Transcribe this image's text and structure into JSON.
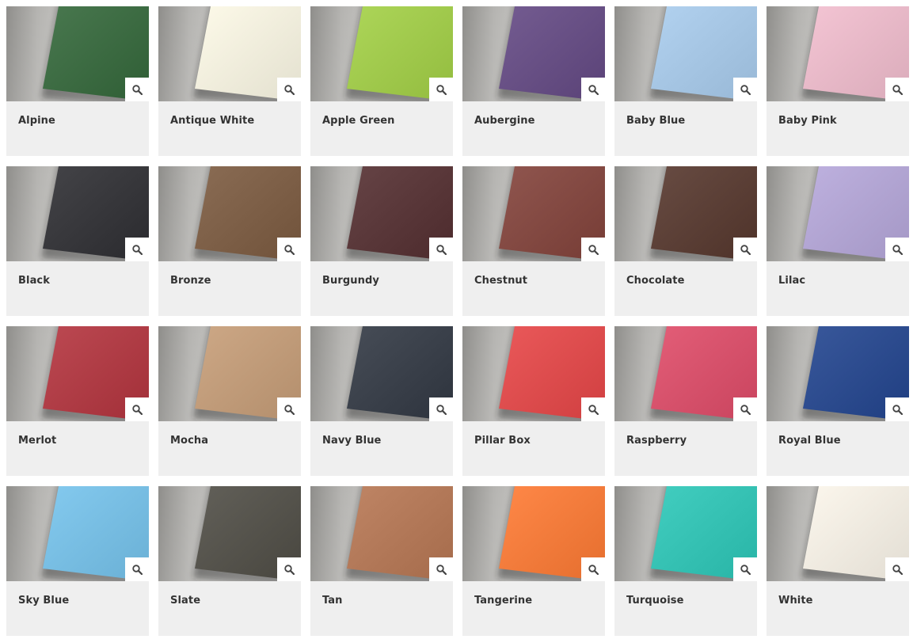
{
  "swatches": [
    {
      "name": "Alpine",
      "color": "#3f6e45"
    },
    {
      "name": "Antique White",
      "color": "#f3f0df"
    },
    {
      "name": "Apple Green",
      "color": "#a3cc4f"
    },
    {
      "name": "Aubergine",
      "color": "#6a5287"
    },
    {
      "name": "Baby Blue",
      "color": "#a8c8e6"
    },
    {
      "name": "Baby Pink",
      "color": "#eabbca"
    },
    {
      "name": "Black",
      "color": "#3a3a3e"
    },
    {
      "name": "Bronze",
      "color": "#80624a"
    },
    {
      "name": "Burgundy",
      "color": "#5c3a3c"
    },
    {
      "name": "Chestnut",
      "color": "#864c45"
    },
    {
      "name": "Chocolate",
      "color": "#5e4239"
    },
    {
      "name": "Lilac",
      "color": "#b4a7d5"
    },
    {
      "name": "Merlot",
      "color": "#b23f48"
    },
    {
      "name": "Mocha",
      "color": "#c39e7c"
    },
    {
      "name": "Navy Blue",
      "color": "#3d434d"
    },
    {
      "name": "Pillar Box",
      "color": "#e04f50"
    },
    {
      "name": "Raspberry",
      "color": "#d9546e"
    },
    {
      "name": "Royal Blue",
      "color": "#2f4e91"
    },
    {
      "name": "Sky Blue",
      "color": "#7ac0e5"
    },
    {
      "name": "Slate",
      "color": "#58564f"
    },
    {
      "name": "Tan",
      "color": "#b57b5b"
    },
    {
      "name": "Tangerine",
      "color": "#f57e3e"
    },
    {
      "name": "Turquoise",
      "color": "#38c4b6"
    },
    {
      "name": "White",
      "color": "#f2ede3"
    }
  ],
  "zoom_icon": "magnifier-icon"
}
